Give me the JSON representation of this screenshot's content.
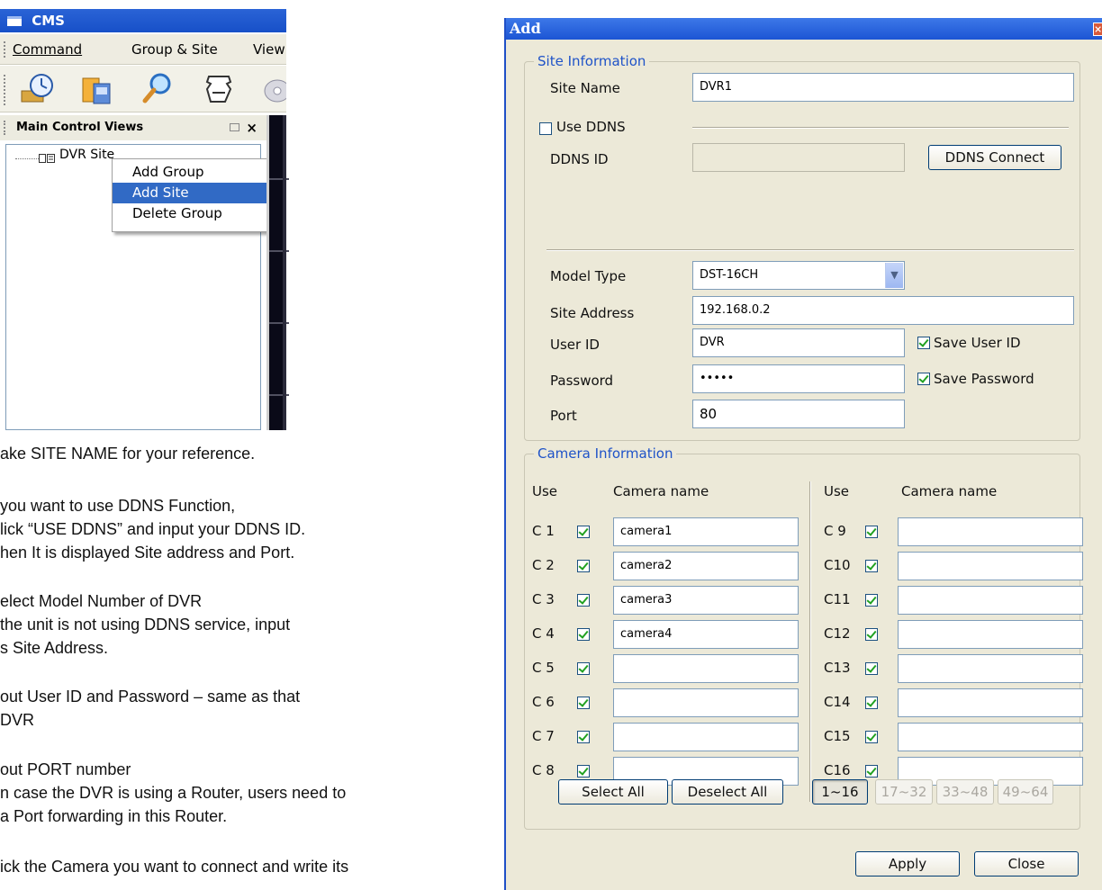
{
  "cms": {
    "title": "CMS",
    "menu": [
      "Command",
      "Group & Site",
      "View"
    ],
    "toolbar_icons": [
      "clock-icon",
      "film-icon",
      "magnifier-icon",
      "camera-icon",
      "disc-icon"
    ],
    "panel_title": "Main Control Views",
    "tree_item": "DVR Site",
    "context_menu": [
      "Add Group",
      "Add Site",
      "Delete Group"
    ],
    "context_selected": "Add Site"
  },
  "notes": [
    "ake SITE NAME for your reference.",
    "you want to use DDNS Function,",
    "lick “USE DDNS” and input your DDNS ID.",
    "hen It is displayed Site address and Port.",
    "elect Model Number of DVR",
    " the unit is not using DDNS service, input",
    "s Site Address.",
    "out User ID and Password – same as that",
    " DVR",
    "out PORT number",
    "n case the DVR is using a Router, users need to",
    "a Port forwarding in this Router.",
    "ick the Camera you want to connect and write its"
  ],
  "dialog": {
    "title": "Add",
    "site_info": {
      "legend": "Site Information",
      "site_name_label": "Site Name",
      "site_name": "DVR1",
      "use_ddns_label": "Use DDNS",
      "use_ddns": false,
      "ddns_id_label": "DDNS ID",
      "ddns_id": "",
      "ddns_connect": "DDNS Connect",
      "model_type_label": "Model Type",
      "model_type": "DST-16CH",
      "site_address_label": "Site Address",
      "site_address": "192.168.0.2",
      "user_id_label": "User ID",
      "user_id": "DVR",
      "save_user_id": "Save User ID",
      "password_label": "Password",
      "password": "•••••",
      "save_password": "Save Password",
      "port_label": "Port",
      "port": "80"
    },
    "camera_info": {
      "legend": "Camera Information",
      "use_header": "Use",
      "name_header": "Camera name",
      "left": [
        {
          "label": "C 1",
          "name": "camera1"
        },
        {
          "label": "C 2",
          "name": "camera2"
        },
        {
          "label": "C 3",
          "name": "camera3"
        },
        {
          "label": "C 4",
          "name": "camera4"
        },
        {
          "label": "C 5",
          "name": ""
        },
        {
          "label": "C 6",
          "name": ""
        },
        {
          "label": "C 7",
          "name": ""
        },
        {
          "label": "C 8",
          "name": ""
        }
      ],
      "right": [
        {
          "label": "C 9",
          "name": ""
        },
        {
          "label": "C10",
          "name": ""
        },
        {
          "label": "C11",
          "name": ""
        },
        {
          "label": "C12",
          "name": ""
        },
        {
          "label": "C13",
          "name": ""
        },
        {
          "label": "C14",
          "name": ""
        },
        {
          "label": "C15",
          "name": ""
        },
        {
          "label": "C16",
          "name": ""
        }
      ],
      "select_all": "Select All",
      "deselect_all": "Deselect All",
      "pages": [
        "1~16",
        "17~32",
        "33~48",
        "49~64"
      ]
    },
    "apply": "Apply",
    "close": "Close"
  }
}
